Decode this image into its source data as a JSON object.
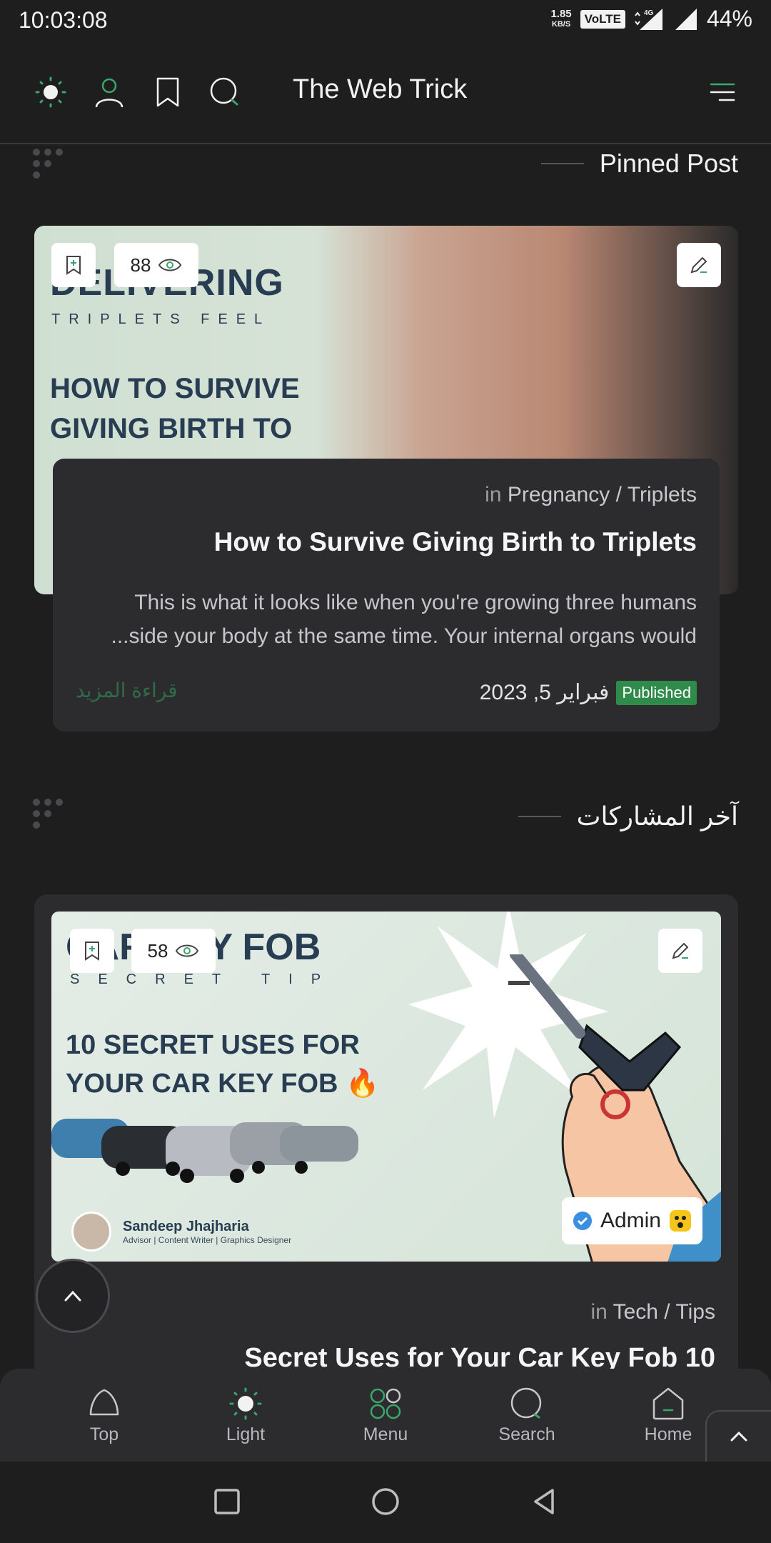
{
  "status_bar": {
    "time": "10:03:08",
    "speed_value": "1.85",
    "speed_unit": "KB/S",
    "volte": "VoLTE",
    "network": "4G",
    "battery": "44%"
  },
  "header": {
    "title": "The Web Trick",
    "icons": [
      "sun-icon",
      "user-icon",
      "bookmark-icon",
      "search-icon",
      "menu-icon"
    ]
  },
  "pinned": {
    "section_title": "Pinned Post",
    "image_text": {
      "line1": "DELIVERING",
      "line2": "TRIPLETS FEEL",
      "line3": "HOW TO SURVIVE",
      "line4": "GIVING BIRTH TO"
    },
    "views": "88",
    "category_prefix": "in",
    "category": "Pregnancy / Triplets",
    "title": "How to Survive Giving Birth to Triplets",
    "excerpt_line1": "This is what it looks like when you're growing three humans",
    "excerpt_line2": "...side your body at the same time. Your internal organs would",
    "status_badge": "Published",
    "date": "فبراير 5, 2023",
    "read_more": "قراءة المزيد"
  },
  "latest": {
    "section_title": "آخر المشاركات",
    "image_text": {
      "line1": "CAR KEY FOB",
      "line2": "SECRET TIP",
      "line3": "10 SECRET USES FOR",
      "line4": "YOUR CAR KEY FOB 🔥",
      "author_name": "Sandeep Jhajharia",
      "author_role": "Advisor | Content Writer | Graphics Designer"
    },
    "views": "58",
    "author_badge": "Admin",
    "category_prefix": "in",
    "category": "Tech / Tips",
    "title": "Secret Uses for Your Car Key Fob 10"
  },
  "bottom_nav": {
    "items": [
      {
        "label": "Top",
        "icon": "top-icon"
      },
      {
        "label": "Light",
        "icon": "sun-icon"
      },
      {
        "label": "Menu",
        "icon": "grid-icon"
      },
      {
        "label": "Search",
        "icon": "search-icon"
      },
      {
        "label": "Home",
        "icon": "home-icon"
      }
    ]
  },
  "colors": {
    "background": "#1e1e1f",
    "card": "#2c2c2e",
    "accent_green": "#2e8b4a",
    "read_more": "#2f6b48"
  }
}
